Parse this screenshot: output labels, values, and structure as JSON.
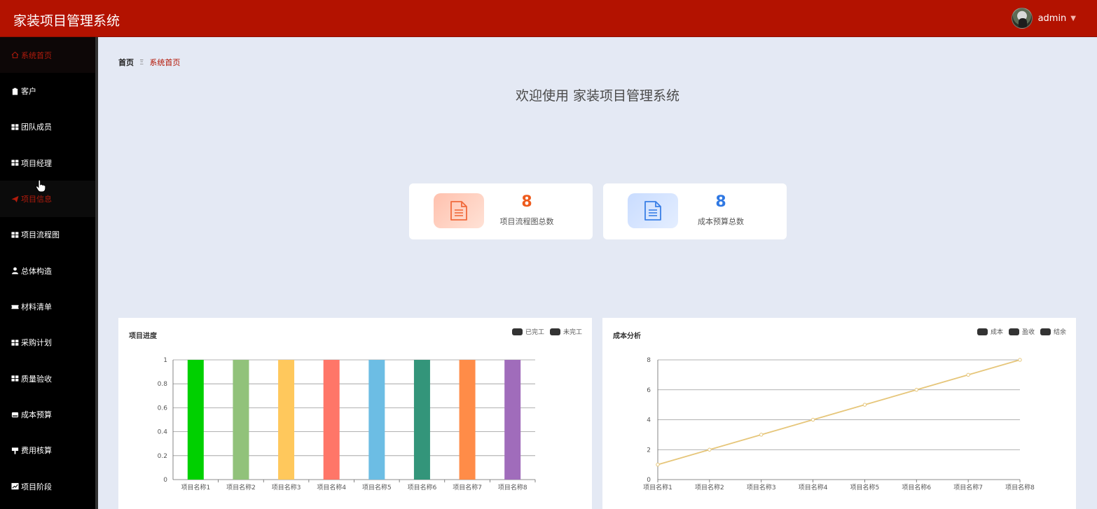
{
  "app": {
    "title": "家装项目管理系统"
  },
  "user": {
    "name": "admin"
  },
  "sidebar": {
    "items": [
      {
        "label": "系统首页",
        "icon": "home-icon",
        "state": "active"
      },
      {
        "label": "客户",
        "icon": "clipboard-icon"
      },
      {
        "label": "团队成员",
        "icon": "grid-icon"
      },
      {
        "label": "项目经理",
        "icon": "grid-icon"
      },
      {
        "label": "项目信息",
        "icon": "send-icon",
        "state": "hover"
      },
      {
        "label": "项目流程图",
        "icon": "grid-icon"
      },
      {
        "label": "总体构造",
        "icon": "user-icon"
      },
      {
        "label": "材料清单",
        "icon": "ticket-icon"
      },
      {
        "label": "采购计划",
        "icon": "grid-icon"
      },
      {
        "label": "质量验收",
        "icon": "grid-icon"
      },
      {
        "label": "成本预算",
        "icon": "hdd-icon"
      },
      {
        "label": "费用核算",
        "icon": "sign-icon"
      },
      {
        "label": "项目阶段",
        "icon": "chart-icon"
      }
    ]
  },
  "breadcrumb": {
    "home": "首页",
    "separator": "Ξ",
    "current": "系统首页"
  },
  "welcome": "欢迎使用 家装项目管理系统",
  "stats": [
    {
      "value": "8",
      "label": "项目流程图总数",
      "color": "#ee5b1c",
      "icon": "document-icon"
    },
    {
      "value": "8",
      "label": "成本预算总数",
      "color": "#2f78e3",
      "icon": "document-icon"
    }
  ],
  "colors": {
    "header": "#b31200",
    "active": "#b21b0c"
  },
  "chart_data": [
    {
      "type": "bar",
      "title": "项目进度",
      "legend": [
        "已完工",
        "未完工"
      ],
      "legend_position": "top-right",
      "categories": [
        "项目名称1",
        "项目名称2",
        "项目名称3",
        "项目名称4",
        "项目名称5",
        "项目名称6",
        "项目名称7",
        "项目名称8"
      ],
      "values": [
        1,
        1,
        1,
        1,
        1,
        1,
        1,
        1
      ],
      "bar_colors": [
        "#00d000",
        "#91c27a",
        "#ffc85c",
        "#ff7668",
        "#6cbde4",
        "#33957a",
        "#ff8c48",
        "#a06cbb"
      ],
      "yticks": [
        "0",
        "0.2",
        "0.4",
        "0.6",
        "0.8",
        "1"
      ],
      "ylim": [
        0,
        1
      ],
      "grid": true
    },
    {
      "type": "line",
      "title": "成本分析",
      "legend": [
        "成本",
        "盈收",
        "结余"
      ],
      "legend_position": "top-right",
      "categories": [
        "项目名称1",
        "项目名称2",
        "项目名称3",
        "项目名称4",
        "项目名称5",
        "项目名称6",
        "项目名称7",
        "项目名称8"
      ],
      "values": [
        1,
        2,
        3,
        4,
        5,
        6,
        7,
        8
      ],
      "line_color": "#e6c67a",
      "yticks": [
        "0",
        "2",
        "4",
        "6",
        "8"
      ],
      "ylim": [
        0,
        8
      ],
      "grid": true
    }
  ]
}
